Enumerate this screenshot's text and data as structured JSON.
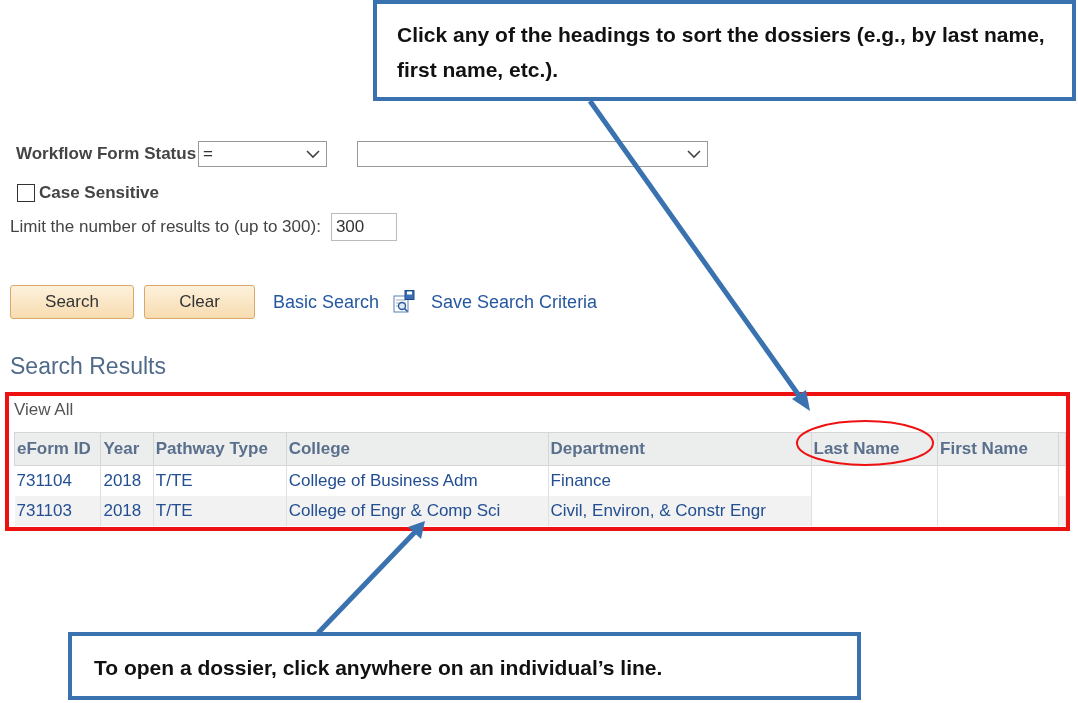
{
  "callouts": [
    {
      "text": "Click any of the headings to sort the dossiers (e.g., by last name, first name, etc.)."
    },
    {
      "text": "To open a dossier, click anywhere on an individual’s line."
    }
  ],
  "filter": {
    "label": "Workflow Form Status",
    "operator": "="
  },
  "case_sensitive": {
    "label": "Case Sensitive",
    "checked": false
  },
  "limit": {
    "label": "Limit the number of results to (up to 300):",
    "value": "300"
  },
  "buttons": [
    "Search",
    "Clear"
  ],
  "links": [
    {
      "label": "Basic Search",
      "icon": false
    },
    {
      "label": "Save Search Criteria",
      "icon": true
    }
  ],
  "results": {
    "title": "Search Results",
    "view_all": "View All",
    "columns": [
      "eForm ID",
      "Year",
      "Pathway Type",
      "College",
      "Department",
      "Last Name",
      "First Name"
    ],
    "rows": [
      [
        "731104",
        "2018",
        "T/TE",
        "College of Business Adm",
        "Finance"
      ],
      [
        "731103",
        "2018",
        "T/TE",
        "College of Engr & Comp Sci",
        "Civil, Environ, & Constr Engr"
      ]
    ]
  }
}
